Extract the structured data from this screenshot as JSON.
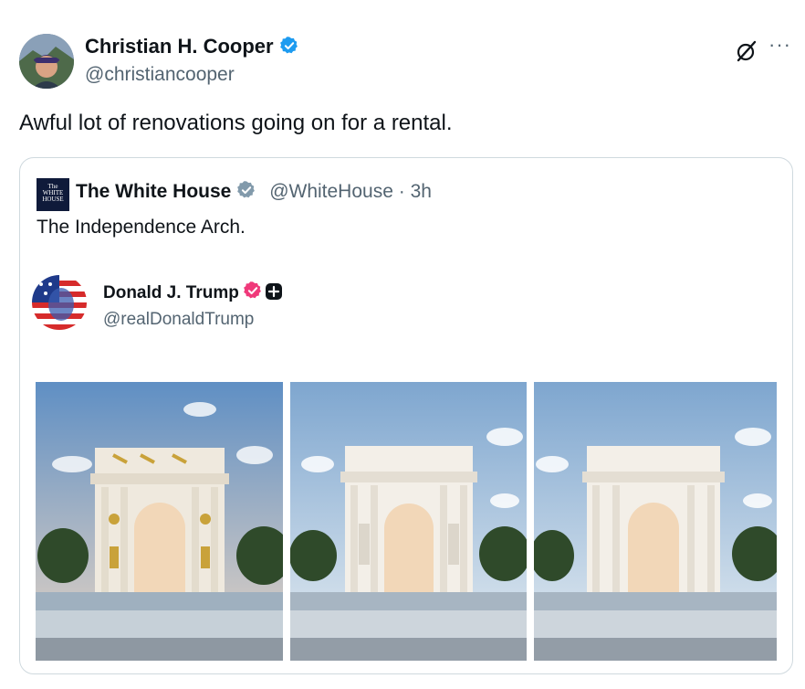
{
  "author": {
    "name": "Christian H. Cooper",
    "handle": "@christiancooper",
    "verified_icon": "verified-badge-icon",
    "avatar_icon": "avatar"
  },
  "actions": {
    "grok_icon": "grok-icon",
    "more_label": "···"
  },
  "tweet": {
    "text": "Awful lot of renovations going on for a rental."
  },
  "quote": {
    "logo_text": "The WHITE HOUSE",
    "name": "The White House",
    "handle": "@WhiteHouse",
    "separator": " · ",
    "time": "3h",
    "text": "The Independence Arch.",
    "embedded": {
      "name": "Donald J. Trump",
      "handle": "@realDonaldTrump"
    },
    "images": [
      {
        "description": "gold-arch"
      },
      {
        "description": "white-arch-statues"
      },
      {
        "description": "white-arch"
      }
    ]
  },
  "colors": {
    "verified_blue": "#1d9bf0",
    "verified_gray": "#829aab",
    "trump_badge": "#f0397a",
    "text": "#0f1419",
    "secondary": "#536471",
    "border": "#cfd9de"
  }
}
